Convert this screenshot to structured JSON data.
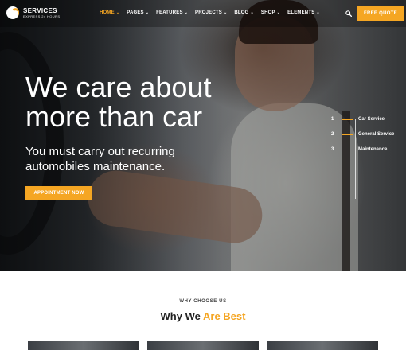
{
  "brand": {
    "title": "SERVICES",
    "subtitle": "EXPRESS 24 HOURS",
    "accent_color": "#f5a623"
  },
  "nav": {
    "items": [
      {
        "label": "HOME",
        "active": true,
        "dropdown": true
      },
      {
        "label": "PAGES",
        "active": false,
        "dropdown": true
      },
      {
        "label": "FEATURES",
        "active": false,
        "dropdown": true
      },
      {
        "label": "PROJECTS",
        "active": false,
        "dropdown": true
      },
      {
        "label": "BLOG",
        "active": false,
        "dropdown": true
      },
      {
        "label": "SHOP",
        "active": false,
        "dropdown": true
      },
      {
        "label": "ELEMENTS",
        "active": false,
        "dropdown": true
      }
    ],
    "search_icon": "search-icon",
    "quote_label": "FREE QUOTE"
  },
  "hero": {
    "headline_line1": "We care about",
    "headline_line2": "more than car",
    "sub_line1": "You must carry out recurring",
    "sub_line2": "automobiles maintenance.",
    "cta_label": "APPOINTMENT NOW",
    "slides": [
      {
        "number": "1",
        "label": "Car Service"
      },
      {
        "number": "2",
        "label": "General Service"
      },
      {
        "number": "3",
        "label": "Maintenance"
      }
    ]
  },
  "section": {
    "eyebrow": "WHY CHOOSE US",
    "title_main": "Why We",
    "title_accent": "Are Best"
  }
}
